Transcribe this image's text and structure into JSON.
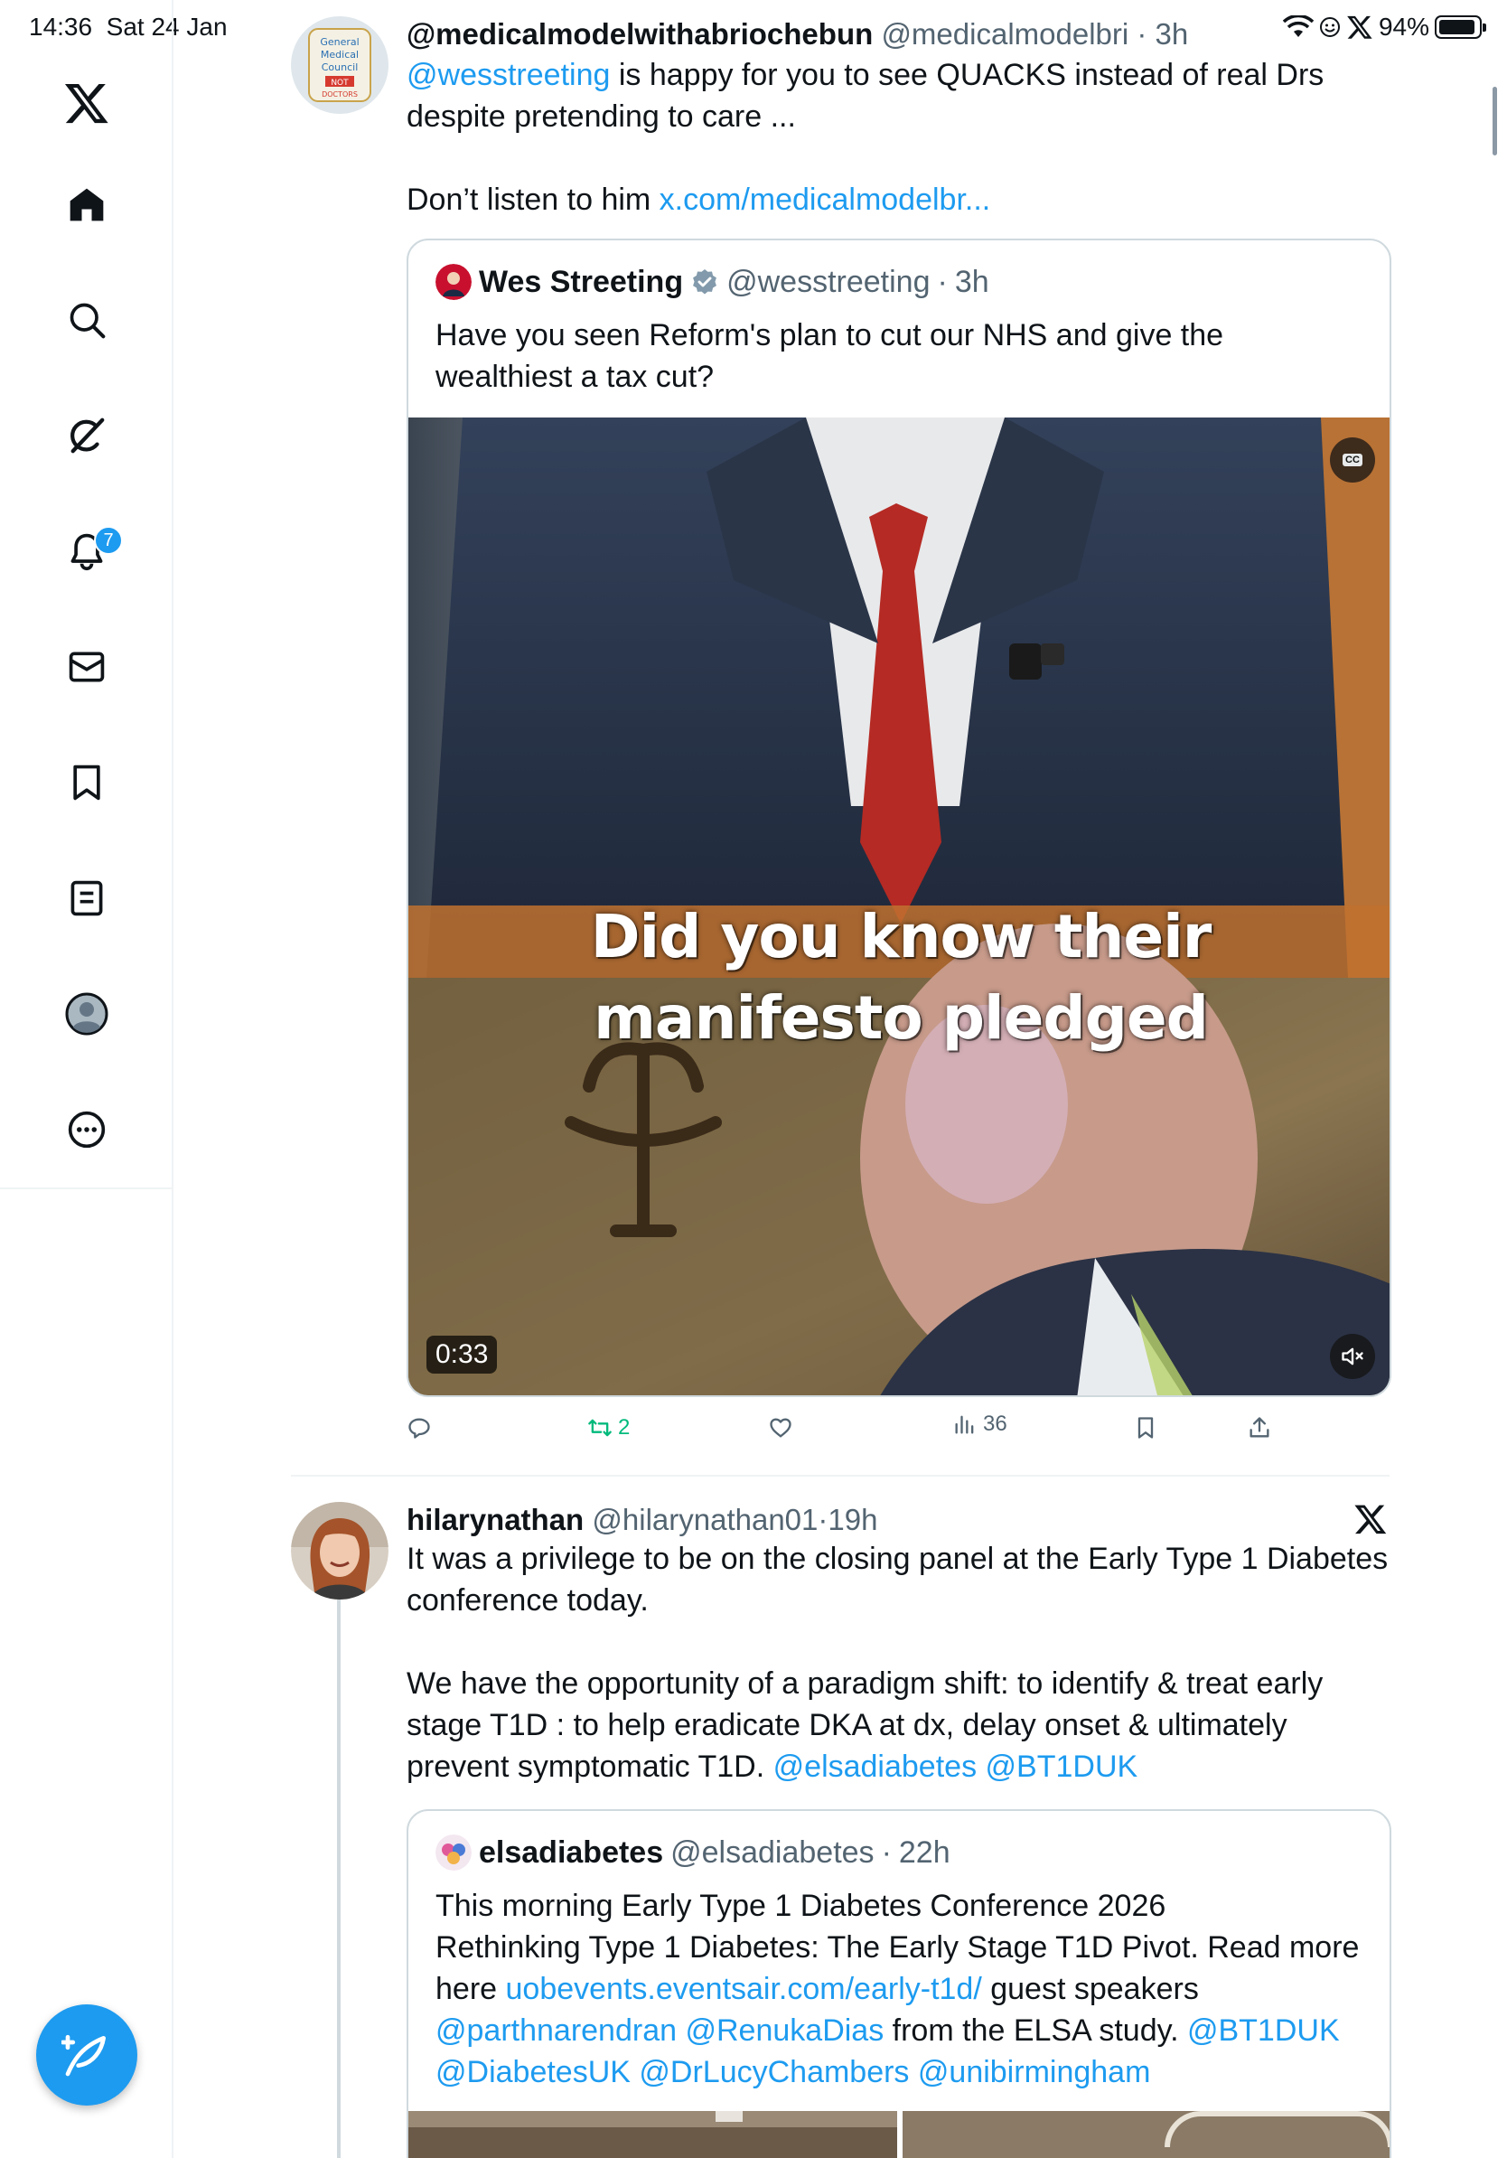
{
  "status_bar": {
    "time": "14:36",
    "date": "Sat 24 Jan",
    "battery": "94%"
  },
  "sidebar": {
    "notifications_badge": "7"
  },
  "tweet1": {
    "display_name": "@medicalmodelwithabriochebun",
    "handle": "@medicalmodelbri",
    "time": "3h",
    "mention": "@wesstreeting",
    "text_line1": " is happy for you to see QUACKS instead of real Drs",
    "text_line2": "despite pretending to care ...",
    "text_line3": "Don’t listen to him ",
    "link": "x.com/medicalmodelbr...",
    "avatar_text": [
      "General",
      "Medical",
      "Council",
      "NOT",
      "DOCTORS"
    ],
    "quote": {
      "name": "Wes Streeting",
      "handle": "@wesstreeting",
      "time": "3h",
      "text_line1": "Have you seen Reform's plan to cut our NHS and give the",
      "text_line2": "wealthiest a tax cut?",
      "caption_line1": "Did you know their",
      "caption_line2": "manifesto pledged",
      "cc_label": "CC",
      "duration": "0:33"
    },
    "stats": {
      "retweets": "2",
      "views": "36"
    }
  },
  "tweet2": {
    "display_name": "hilarynathan",
    "handle": "@hilarynathan01",
    "time": "19h",
    "line1": "It was a privilege to be on the closing panel at the Early Type 1 Diabetes",
    "line2": "conference today.",
    "line3": "We have the opportunity of a paradigm shift: to identify & treat early",
    "line4": "stage T1D : to help eradicate DKA at dx, delay onset & ultimately",
    "line5": "prevent symptomatic T1D.  ",
    "mention1": "@elsadiabetes",
    "mention2": "@BT1DUK",
    "quote": {
      "name": "elsadiabetes",
      "handle": "@elsadiabetes",
      "time": "22h",
      "line1": "This morning Early Type 1 Diabetes Conference 2026",
      "line2": "Rethinking Type 1 Diabetes: The Early Stage T1D Pivot. Read more",
      "line3_pre": "here ",
      "line3_link": "uobevents.eventsair.com/early-t1d/",
      "line3_post": "  guest speakers",
      "line4_m1": "@parthnarendran",
      "line4_m2": "@RenukaDias",
      "line4_mid": "  from the ELSA study. ",
      "line4_m3": "@BT1DUK",
      "line5_m1": "@DiabetesUK",
      "line5_m2": "@DrLucyChambers",
      "line5_m3": "@unibirmingham"
    }
  },
  "colors": {
    "accent": "#1d9bf0",
    "retweet_green": "#00ba7c",
    "text_secondary": "#536471"
  }
}
